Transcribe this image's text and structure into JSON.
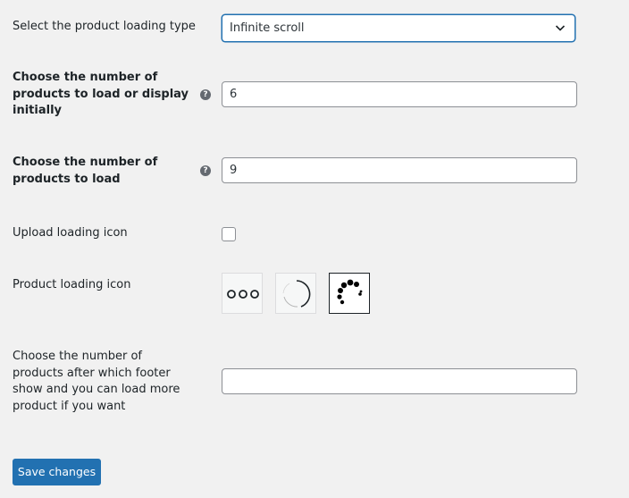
{
  "settings": {
    "loading_type": {
      "label": "Select the product loading type",
      "value": "Infinite scroll"
    },
    "initial_count": {
      "label_lines": [
        "Choose the number of",
        "products to load or display",
        "initially"
      ],
      "help": "?",
      "value": "6"
    },
    "load_count": {
      "label_lines": [
        "Choose the number of",
        "products to load"
      ],
      "help": "?",
      "value": "9"
    },
    "upload_icon": {
      "label": "Upload loading icon",
      "checked": false
    },
    "loading_icon": {
      "label": "Product loading icon",
      "options": [
        {
          "icon": "three-dots-icon",
          "selected": false
        },
        {
          "icon": "spinner-ring-icon",
          "selected": false
        },
        {
          "icon": "dotted-spinner-icon",
          "selected": true
        }
      ]
    },
    "footer_after": {
      "label_lines": [
        "Choose the number of",
        "products after which footer",
        "show and you can load more",
        "product if you want"
      ],
      "value": ""
    }
  },
  "actions": {
    "save_label": "Save changes"
  },
  "colors": {
    "background": "#f1f1f1",
    "accent": "#2271b1",
    "text": "#1d2327"
  }
}
